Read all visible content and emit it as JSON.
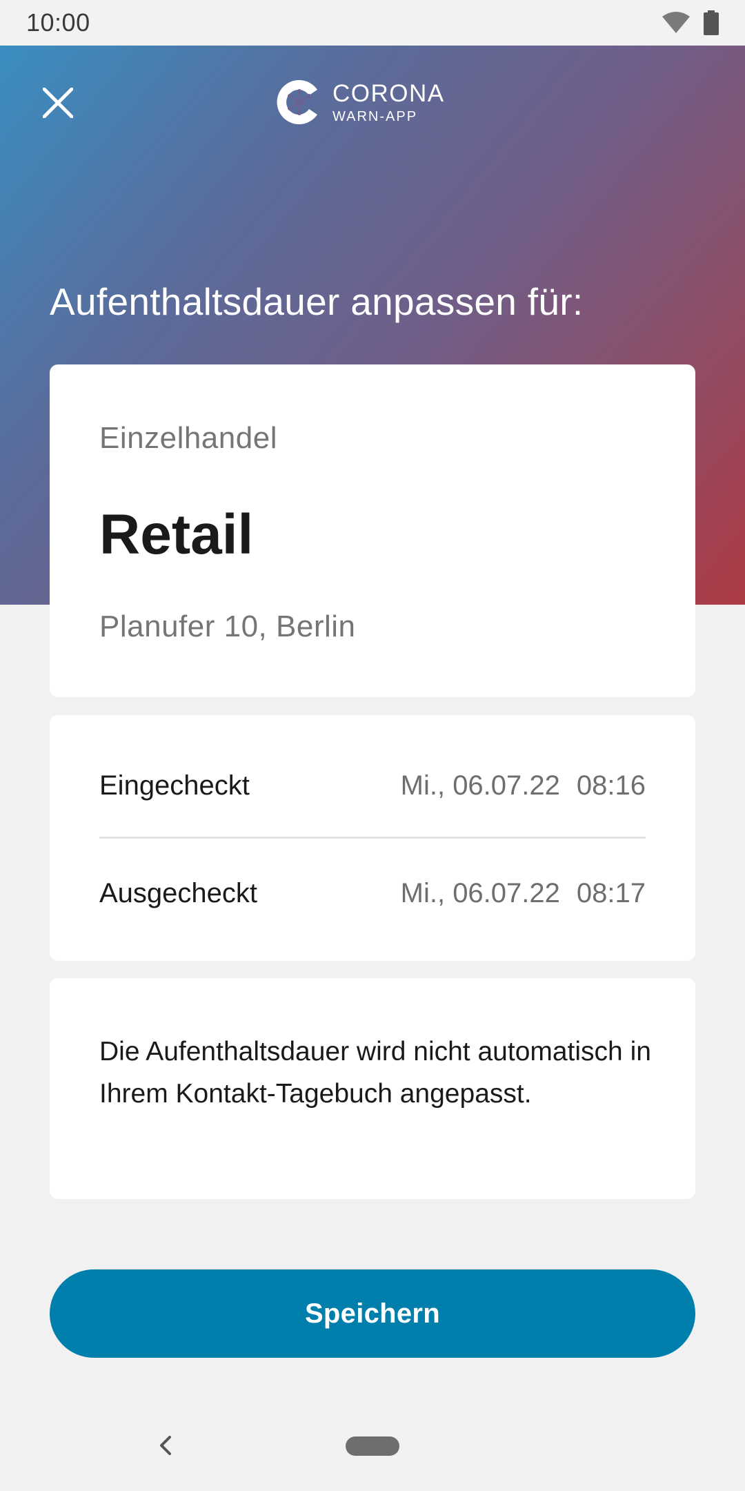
{
  "status_bar": {
    "time": "10:00",
    "icons": [
      "wifi-icon",
      "battery-icon"
    ]
  },
  "header": {
    "close_icon": "close-icon",
    "logo": {
      "line1": "CORONA",
      "line2": "WARN-APP"
    },
    "title": "Aufenthaltsdauer anpassen für:"
  },
  "location": {
    "category": "Einzelhandel",
    "name": "Retail",
    "address": "Planufer 10, Berlin"
  },
  "times": {
    "checked_in": {
      "label": "Eingecheckt",
      "date": "Mi., 06.07.22",
      "time": "08:16"
    },
    "checked_out": {
      "label": "Ausgecheckt",
      "date": "Mi., 06.07.22",
      "time": "08:17"
    }
  },
  "note": "Die Aufenthaltsdauer wird nicht automatisch in Ihrem Kontakt-Tagebuch angepasst.",
  "actions": {
    "save_label": "Speichern"
  },
  "colors": {
    "primary_button": "#007fad",
    "gradient_start": "#3a8ec2",
    "gradient_end": "#ad3a44"
  }
}
